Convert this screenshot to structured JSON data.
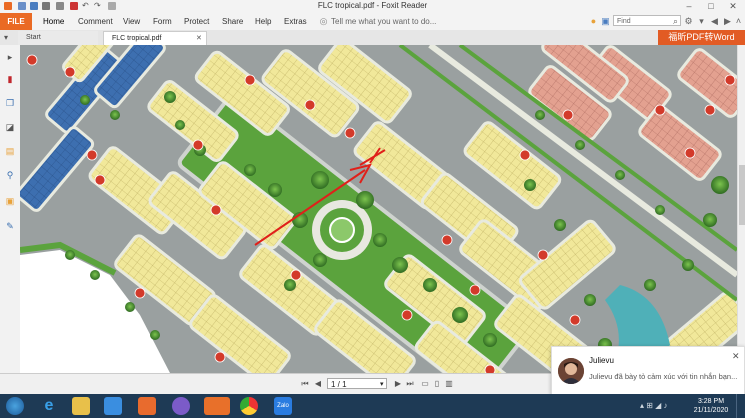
{
  "window": {
    "title": "FLC tropical.pdf - Foxit Reader",
    "file_tab": "FILE"
  },
  "ribbon": {
    "tabs": [
      "Home",
      "Comment",
      "View",
      "Form",
      "Protect",
      "Share",
      "Help",
      "Extras"
    ],
    "tell_me": "Tell me what you want to do...",
    "find_placeholder": "Find"
  },
  "doc_tabs": [
    {
      "label": "Start"
    },
    {
      "label": "FLC tropical.pdf"
    }
  ],
  "promo_button": "福昕PDF转Word",
  "statusbar": {
    "page_value": "1 / 1"
  },
  "notification": {
    "name": "Julievu",
    "message": "Julievu đã bày tỏ cảm xúc với tin nhắn bạn..."
  },
  "taskbar": {
    "time": "3:28 PM",
    "date": "21/11/2020",
    "zalo_label": "Zalo"
  },
  "colors": {
    "accent": "#ea6a24",
    "plot_yellow": "#f1e89a",
    "plot_blue": "#3d6fb0",
    "plot_pink": "#e3a190",
    "marker_red": "#d33a2a",
    "grass": "#5ba33d",
    "road": "#9aa0a0"
  }
}
